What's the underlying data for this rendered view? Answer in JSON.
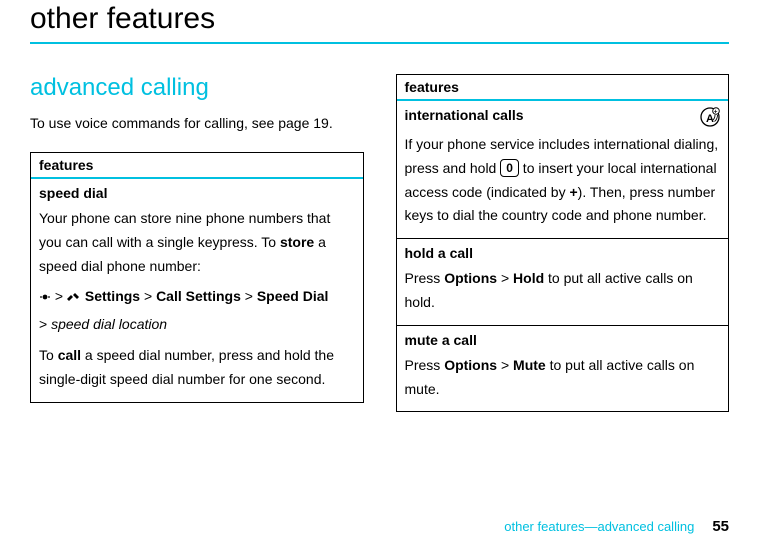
{
  "page": {
    "title": "other features",
    "section_heading": "advanced calling",
    "intro": "To use voice commands for calling, see page 19.",
    "footer_text": "other features—advanced calling",
    "page_number": "55"
  },
  "left_box": {
    "header": "features",
    "speed_dial": {
      "title": "speed dial",
      "p1_a": "Your phone can store nine phone numbers that you can call with a single keypress. To ",
      "p1_b_bold": "store",
      "p1_c": " a speed dial phone number:",
      "nav_sep": " > ",
      "nav_settings": "Settings",
      "nav_call_settings": "Call Settings",
      "nav_speed_dial": "Speed Dial",
      "nav_location": "speed dial location",
      "p2_a": "To ",
      "p2_b_bold": "call",
      "p2_c": " a speed dial number, press and hold the single-digit speed dial number for one second."
    }
  },
  "right_box": {
    "header": "features",
    "intl": {
      "title": "international calls",
      "t1": "If your phone service includes international dialing, press and hold ",
      "key": "0",
      "t2": " to insert your local international access code (indicated by ",
      "plus_bold": "+",
      "t3": "). Then, press number keys to dial the country code and phone number."
    },
    "hold": {
      "title": "hold a call",
      "t1": "Press ",
      "b1": "Options",
      "sep": " > ",
      "b2": "Hold",
      "t2": " to put all active calls on hold."
    },
    "mute": {
      "title": "mute a call",
      "t1": "Press ",
      "b1": "Options",
      "sep": " > ",
      "b2": "Mute",
      "t2": " to put all active calls on mute."
    }
  }
}
